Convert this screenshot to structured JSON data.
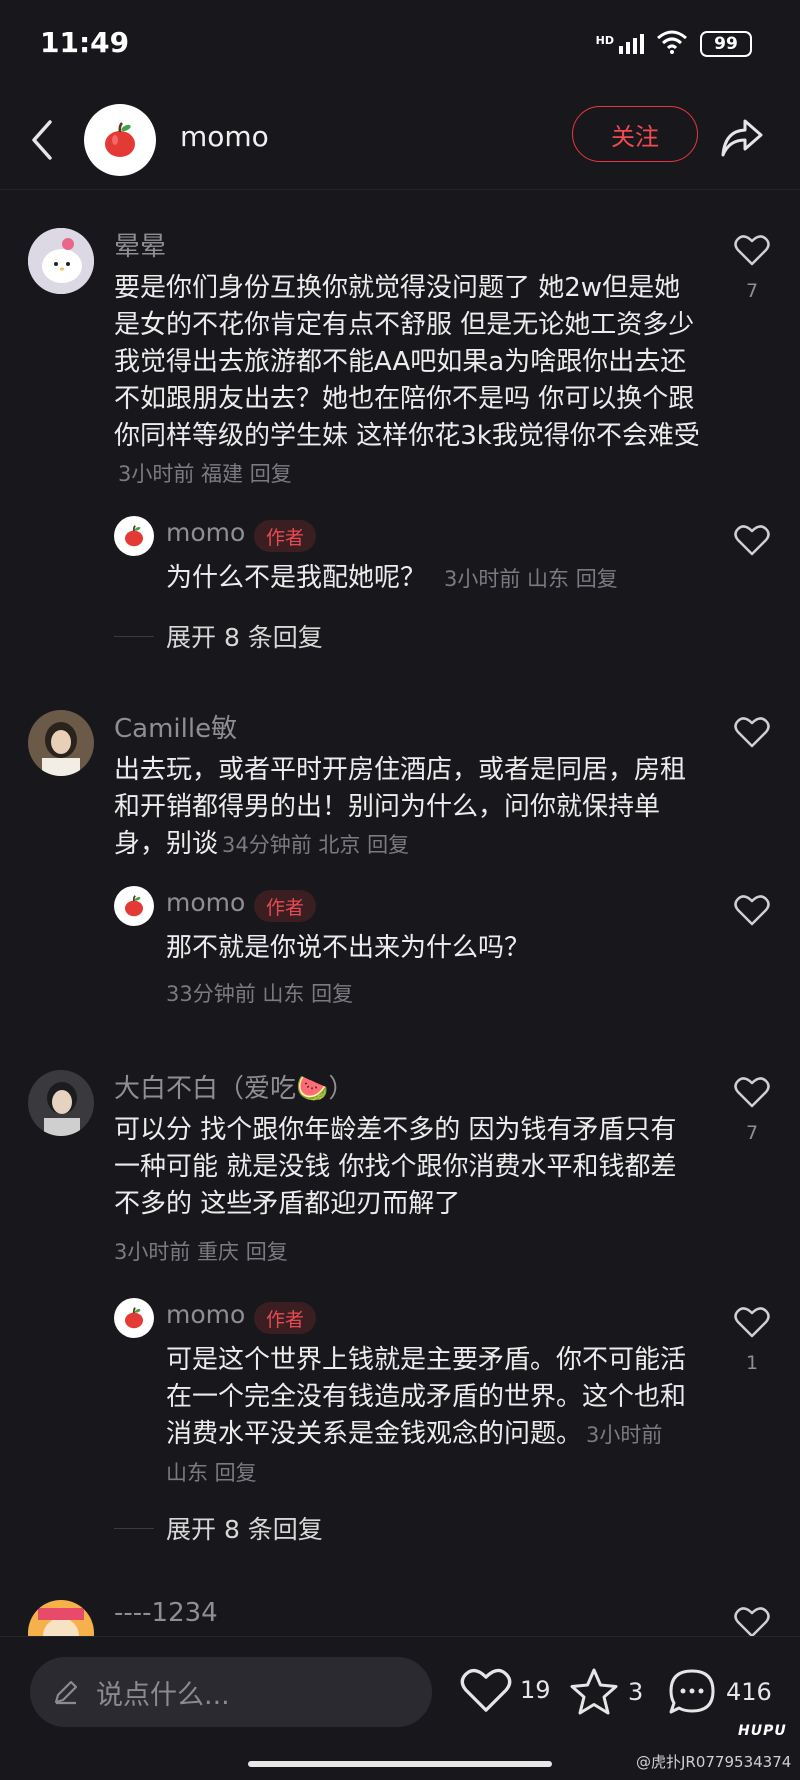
{
  "status": {
    "time": "11:49",
    "signal": "HD",
    "battery": "99"
  },
  "header": {
    "author_name": "momo",
    "follow_label": "关注"
  },
  "comments": [
    {
      "name": "晕晕",
      "text": "要是你们身份互换你就觉得没问题了 她2w但是她是女的不花你肯定有点不舒服 但是无论她工资多少我觉得出去旅游都不能AA吧如果a为啥跟你出去还不如跟朋友出去？她也在陪你不是吗 你可以换个跟你同样等级的学生妹 这样你花3k我觉得你不会难受",
      "meta": "3小时前 福建 回复",
      "likes": "7",
      "reply": {
        "name": "momo",
        "tag": "作者",
        "text": "为什么不是我配她呢？",
        "meta": "3小时前 山东 回复"
      },
      "expand": "展开 8 条回复"
    },
    {
      "name": "Camille敏",
      "text": "出去玩，或者平时开房住酒店，或者是同居，房租和开销都得男的出！别问为什么，问你就保持单身，别谈",
      "meta": "34分钟前 北京 回复",
      "likes": "",
      "reply": {
        "name": "momo",
        "tag": "作者",
        "text": "那不就是你说不出来为什么吗？",
        "meta": "33分钟前 山东 回复"
      }
    },
    {
      "name": "大白不白（爱吃🍉）",
      "text": "可以分 找个跟你年龄差不多的 因为钱有矛盾只有一种可能 就是没钱 你找个跟你消费水平和钱都差不多的 这些矛盾都迎刃而解了",
      "meta": "3小时前 重庆 回复",
      "likes": "7",
      "reply": {
        "name": "momo",
        "tag": "作者",
        "text": "可是这个世界上钱就是主要矛盾。你不可能活在一个完全没有钱造成矛盾的世界。这个也和消费水平没关系是金钱观念的问题。",
        "meta": "3小时前 山东 回复",
        "likes": "1"
      },
      "expand": "展开 8 条回复"
    },
    {
      "name": "----1234"
    }
  ],
  "bottom": {
    "placeholder": "说点什么...",
    "likes": "19",
    "favorites": "3",
    "comments": "416",
    "watermark_logo": "HUPU",
    "watermark": "@虎扑JR0779534374"
  }
}
